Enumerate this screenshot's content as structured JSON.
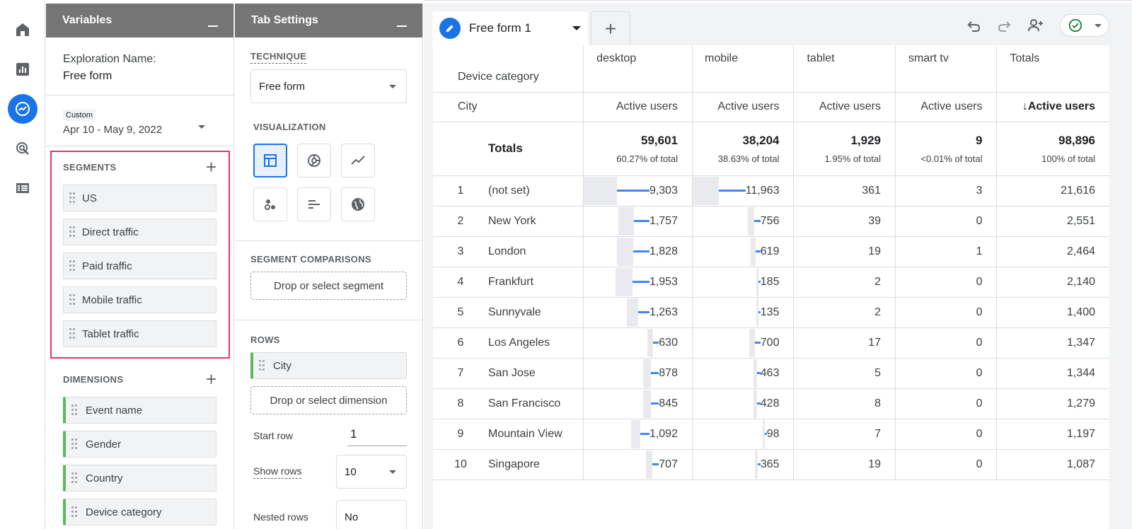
{
  "nav": {
    "items": [
      "home",
      "reports",
      "explore",
      "advertising",
      "configure"
    ]
  },
  "variables": {
    "title": "Variables",
    "exploration_label": "Exploration Name:",
    "exploration_value": "Free form",
    "date_chip": "Custom",
    "date_range": "Apr 10 - May 9, 2022",
    "segments_title": "SEGMENTS",
    "segments": [
      "US",
      "Direct traffic",
      "Paid traffic",
      "Mobile traffic",
      "Tablet traffic"
    ],
    "dimensions_title": "DIMENSIONS",
    "dimensions": [
      "Event name",
      "Gender",
      "Country",
      "Device category"
    ]
  },
  "tab_settings": {
    "title": "Tab Settings",
    "technique_label": "TECHNIQUE",
    "technique_value": "Free form",
    "visualization_label": "VISUALIZATION",
    "segment_comparisons_label": "SEGMENT COMPARISONS",
    "segment_drop": "Drop or select segment",
    "rows_label": "ROWS",
    "rows_item": "City",
    "dimension_drop": "Drop or select dimension",
    "start_row_label": "Start row",
    "start_row_value": "1",
    "show_rows_label": "Show rows",
    "show_rows_value": "10",
    "nested_label": "Nested rows",
    "nested_value": "No"
  },
  "tab": {
    "label": "Free form 1"
  },
  "colors": {
    "accent": "#1a73e8",
    "bar": "#4285f4",
    "segment_highlight": "#e5326f",
    "dimension_marker": "#5cb85c",
    "header": "#757575"
  },
  "table": {
    "pivot_label": "Device category",
    "row_label": "City",
    "columns": [
      {
        "name": "desktop",
        "metric": "Active users"
      },
      {
        "name": "mobile",
        "metric": "Active users"
      },
      {
        "name": "tablet",
        "metric": "Active users"
      },
      {
        "name": "smart tv",
        "metric": "Active users"
      },
      {
        "name": "Totals",
        "metric": "Active users",
        "sorted": "↓"
      }
    ],
    "totals_label": "Totals",
    "totals": [
      {
        "value": "59,601",
        "pct": "60.27% of total"
      },
      {
        "value": "38,204",
        "pct": "38.63% of total"
      },
      {
        "value": "1,929",
        "pct": "1.95% of total"
      },
      {
        "value": "9",
        "pct": "<0.01% of total"
      },
      {
        "value": "98,896",
        "pct": "100% of total"
      }
    ],
    "rows": [
      {
        "rank": "1",
        "city": "(not set)",
        "values": [
          "9,303",
          "11,963",
          "361",
          "3",
          "21,616"
        ],
        "desktop_share": 0.78,
        "mobile_share": 1.0
      },
      {
        "rank": "2",
        "city": "New York",
        "values": [
          "1,757",
          "756",
          "39",
          "0",
          "2,551"
        ],
        "desktop_share": 0.147,
        "mobile_share": 0.063
      },
      {
        "rank": "3",
        "city": "London",
        "values": [
          "1,828",
          "619",
          "19",
          "1",
          "2,464"
        ],
        "desktop_share": 0.153,
        "mobile_share": 0.052
      },
      {
        "rank": "4",
        "city": "Frankfurt",
        "values": [
          "1,953",
          "185",
          "2",
          "0",
          "2,140"
        ],
        "desktop_share": 0.163,
        "mobile_share": 0.015
      },
      {
        "rank": "5",
        "city": "Sunnyvale",
        "values": [
          "1,263",
          "135",
          "2",
          "0",
          "1,400"
        ],
        "desktop_share": 0.106,
        "mobile_share": 0.011
      },
      {
        "rank": "6",
        "city": "Los Angeles",
        "values": [
          "630",
          "700",
          "17",
          "0",
          "1,347"
        ],
        "desktop_share": 0.053,
        "mobile_share": 0.059
      },
      {
        "rank": "7",
        "city": "San Jose",
        "values": [
          "878",
          "463",
          "5",
          "0",
          "1,344"
        ],
        "desktop_share": 0.073,
        "mobile_share": 0.039
      },
      {
        "rank": "8",
        "city": "San Francisco",
        "values": [
          "845",
          "428",
          "8",
          "0",
          "1,279"
        ],
        "desktop_share": 0.071,
        "mobile_share": 0.036
      },
      {
        "rank": "9",
        "city": "Mountain View",
        "values": [
          "1,092",
          "98",
          "7",
          "0",
          "1,197"
        ],
        "desktop_share": 0.091,
        "mobile_share": 0.008
      },
      {
        "rank": "10",
        "city": "Singapore",
        "values": [
          "707",
          "365",
          "19",
          "0",
          "1,087"
        ],
        "desktop_share": 0.059,
        "mobile_share": 0.031
      }
    ]
  }
}
